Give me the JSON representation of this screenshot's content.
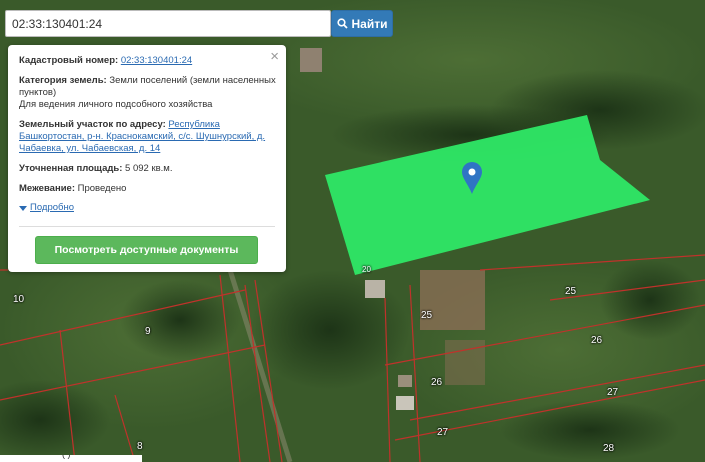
{
  "search": {
    "value": "02:33:130401:24",
    "button_label": "Найти"
  },
  "info": {
    "cadastral_label": "Кадастровый номер:",
    "cadastral_value": "02:33:130401:24",
    "category_label": "Категория земель:",
    "category_value": "Земли поселений (земли населенных пунктов)",
    "use_value": "Для ведения личного подсобного хозяйства",
    "address_label": "Земельный участок по адресу:",
    "address_value": "Республика Башкортостан, р-н. Краснокамский, с/с. Шушнурский, д. Чабаевка, ул. Чабаевская, д. 14",
    "area_label": "Уточненная площадь:",
    "area_value": "5 092 кв.м.",
    "survey_label": "Межевание:",
    "survey_value": "Проведено",
    "more_label": "Подробно",
    "docs_button": "Посмотреть доступные документы",
    "close_symbol": "×"
  },
  "map": {
    "plot_labels": [
      "10",
      "9",
      "8",
      "25",
      "25",
      "26",
      "26",
      "27",
      "27",
      "28",
      "20"
    ],
    "highlight_color": "#2ee866",
    "boundary_color": "#c0322b",
    "marker_color": "#2f74c4"
  },
  "footer": {
    "text": "( )"
  }
}
